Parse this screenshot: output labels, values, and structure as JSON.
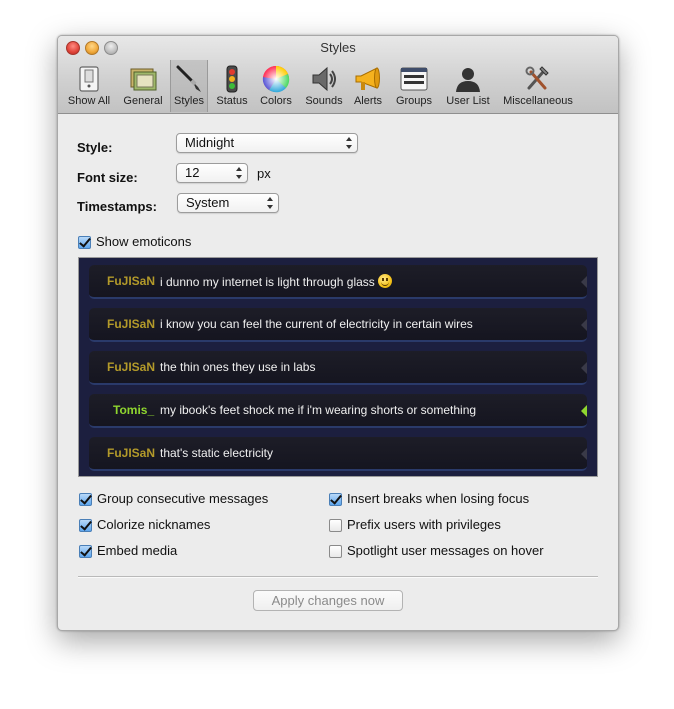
{
  "window": {
    "title": "Styles"
  },
  "toolbar": {
    "items": [
      {
        "label": "Show All",
        "icon": "show-all-icon"
      },
      {
        "label": "General",
        "icon": "general-icon"
      },
      {
        "label": "Styles",
        "icon": "styles-brush-icon",
        "selected": true
      },
      {
        "label": "Status",
        "icon": "status-traffic-light-icon"
      },
      {
        "label": "Colors",
        "icon": "color-wheel-icon"
      },
      {
        "label": "Sounds",
        "icon": "speaker-icon"
      },
      {
        "label": "Alerts",
        "icon": "megaphone-icon"
      },
      {
        "label": "Groups",
        "icon": "groups-icon"
      },
      {
        "label": "User List",
        "icon": "user-silhouette-icon"
      },
      {
        "label": "Miscellaneous",
        "icon": "tools-icon"
      }
    ]
  },
  "form": {
    "style_label": "Style:",
    "style_value": "Midnight",
    "font_size_label": "Font size:",
    "font_size_value": "12",
    "font_size_unit": "px",
    "timestamps_label": "Timestamps:",
    "timestamps_value": "System"
  },
  "show_emoticons": {
    "label": "Show emoticons",
    "checked": true
  },
  "preview": {
    "messages": [
      {
        "nick": "FuJISaN",
        "text": "i dunno my internet is light through glass",
        "emoticon": "smiley-icon",
        "highlight": false
      },
      {
        "nick": "FuJISaN",
        "text": "i know you can feel the current of electricity in certain wires",
        "highlight": false
      },
      {
        "nick": "FuJISaN",
        "text": "the thin ones they use in labs",
        "highlight": false
      },
      {
        "nick": "Tomis_",
        "text": "my ibook's feet shock me if i'm wearing shorts or something",
        "highlight": true
      },
      {
        "nick": "FuJISaN",
        "text": "that's static electricity",
        "highlight": false
      }
    ],
    "nick_color_default": "#b39a2a",
    "nick_color_highlight": "#8fd62f",
    "background_color": "#1c1f3f"
  },
  "options": {
    "group_consecutive": {
      "label": "Group consecutive messages",
      "checked": true
    },
    "colorize_nicknames": {
      "label": "Colorize nicknames",
      "checked": true
    },
    "embed_media": {
      "label": "Embed media",
      "checked": true
    },
    "insert_breaks": {
      "label": "Insert breaks when losing focus",
      "checked": true
    },
    "prefix_privileges": {
      "label": "Prefix users with privileges",
      "checked": false
    },
    "spotlight_hover": {
      "label": "Spotlight user messages on hover",
      "checked": false
    }
  },
  "apply_button": {
    "label": "Apply changes now",
    "enabled": false
  }
}
